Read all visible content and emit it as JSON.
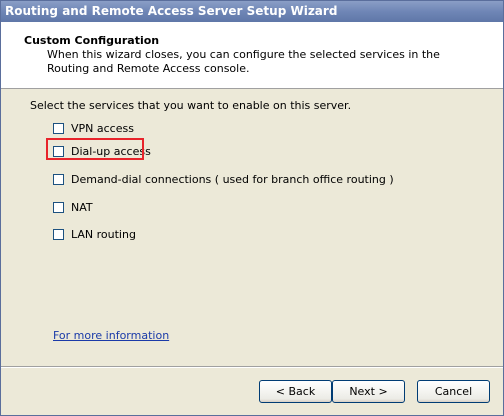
{
  "window": {
    "title": "Routing and Remote Access Server Setup Wizard"
  },
  "header": {
    "title": "Custom Configuration",
    "description": "When this wizard closes, you can configure the selected services in the Routing and Remote Access console."
  },
  "body": {
    "prompt": "Select the services that you want to enable on this server.",
    "options": [
      {
        "label": "VPN access",
        "checked": false
      },
      {
        "label": "Dial-up access",
        "checked": false,
        "highlighted": true
      },
      {
        "label": "Demand-dial connections ( used for branch office routing )",
        "checked": false
      },
      {
        "label": "NAT",
        "checked": false
      },
      {
        "label": "LAN routing",
        "checked": false
      }
    ],
    "more_info_link": "For more information"
  },
  "footer": {
    "back_label": "< Back",
    "next_label": "Next >",
    "cancel_label": "Cancel"
  },
  "colors": {
    "titlebar": "#6f86b6",
    "dialog_bg": "#ece9d8",
    "highlight_box": "#e8242b",
    "link": "#1a3aa8"
  }
}
